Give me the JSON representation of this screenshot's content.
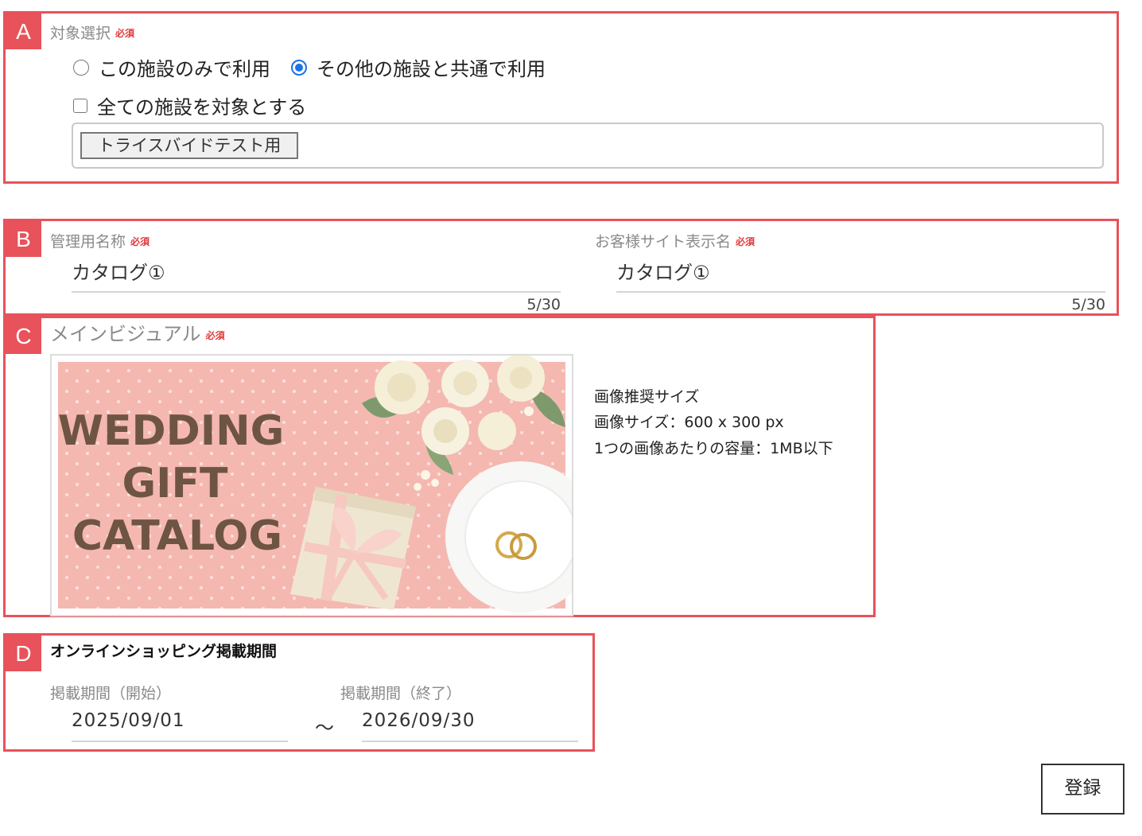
{
  "sections": {
    "a": {
      "letter": "A"
    },
    "b": {
      "letter": "B"
    },
    "c": {
      "letter": "C"
    },
    "d": {
      "letter": "D"
    }
  },
  "target_selection": {
    "label": "対象選択",
    "required": "必須",
    "options": [
      {
        "label": "この施設のみで利用",
        "checked": false
      },
      {
        "label": "その他の施設と共通で利用",
        "checked": true
      }
    ],
    "all_facilities_label": "全ての施設を対象とする",
    "all_facilities_checked": false,
    "selected_facility": "トライスバイドテスト用"
  },
  "names": {
    "admin": {
      "label": "管理用名称",
      "required": "必須",
      "value": "カタログ①",
      "counter": "5/30"
    },
    "customer": {
      "label": "お客様サイト表示名",
      "required": "必須",
      "value": "カタログ①",
      "counter": "5/30"
    }
  },
  "main_visual": {
    "label": "メインビジュアル",
    "required": "必須",
    "image_text": [
      "WEDDING",
      "GIFT",
      "CATALOG"
    ],
    "hints": [
      "画像推奨サイズ",
      "画像サイズ：600 x 300 px",
      "1つの画像あたりの容量：1MB以下"
    ]
  },
  "period": {
    "title": "オンラインショッピング掲載期間",
    "start_label": "掲載期間（開始）",
    "start_value": "2025/09/01",
    "separator": "～",
    "end_label": "掲載期間（終了）",
    "end_value": "2026/09/30"
  },
  "actions": {
    "register_label": "登録"
  },
  "colors": {
    "accent": "#e8525a",
    "radio_selected": "#1a73e8",
    "required": "#e03a3a"
  }
}
